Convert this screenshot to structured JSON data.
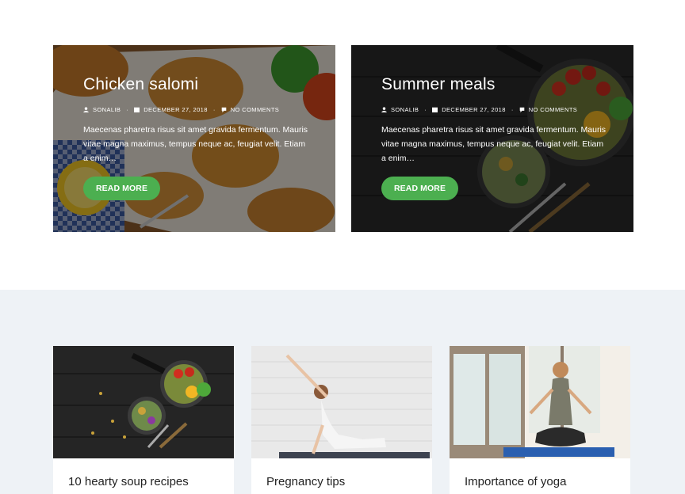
{
  "featured_posts": [
    {
      "title": "Chicken salomi",
      "author": "SONALIB",
      "date": "DECEMBER 27, 2018",
      "comments": "NO COMMENTS",
      "excerpt": "Maecenas pharetra risus sit amet gravida fermentum. Mauris vitae magna maximus, tempus neque ac, feugiat velit. Etiam a enim…",
      "button": "READ MORE"
    },
    {
      "title": "Summer meals",
      "author": "SONALIB",
      "date": "DECEMBER 27, 2018",
      "comments": "NO COMMENTS",
      "excerpt": "Maecenas pharetra risus sit amet gravida fermentum. Mauris vitae magna maximus, tempus neque ac, feugiat velit. Etiam a enim…",
      "button": "READ MORE"
    }
  ],
  "posts": [
    {
      "title": "10 hearty soup recipes"
    },
    {
      "title": "Pregnancy tips"
    },
    {
      "title": "Importance of yoga"
    }
  ],
  "colors": {
    "accent": "#4caf50",
    "band": "#eef2f6"
  },
  "icons": [
    "user-icon",
    "calendar-icon",
    "comment-icon"
  ]
}
